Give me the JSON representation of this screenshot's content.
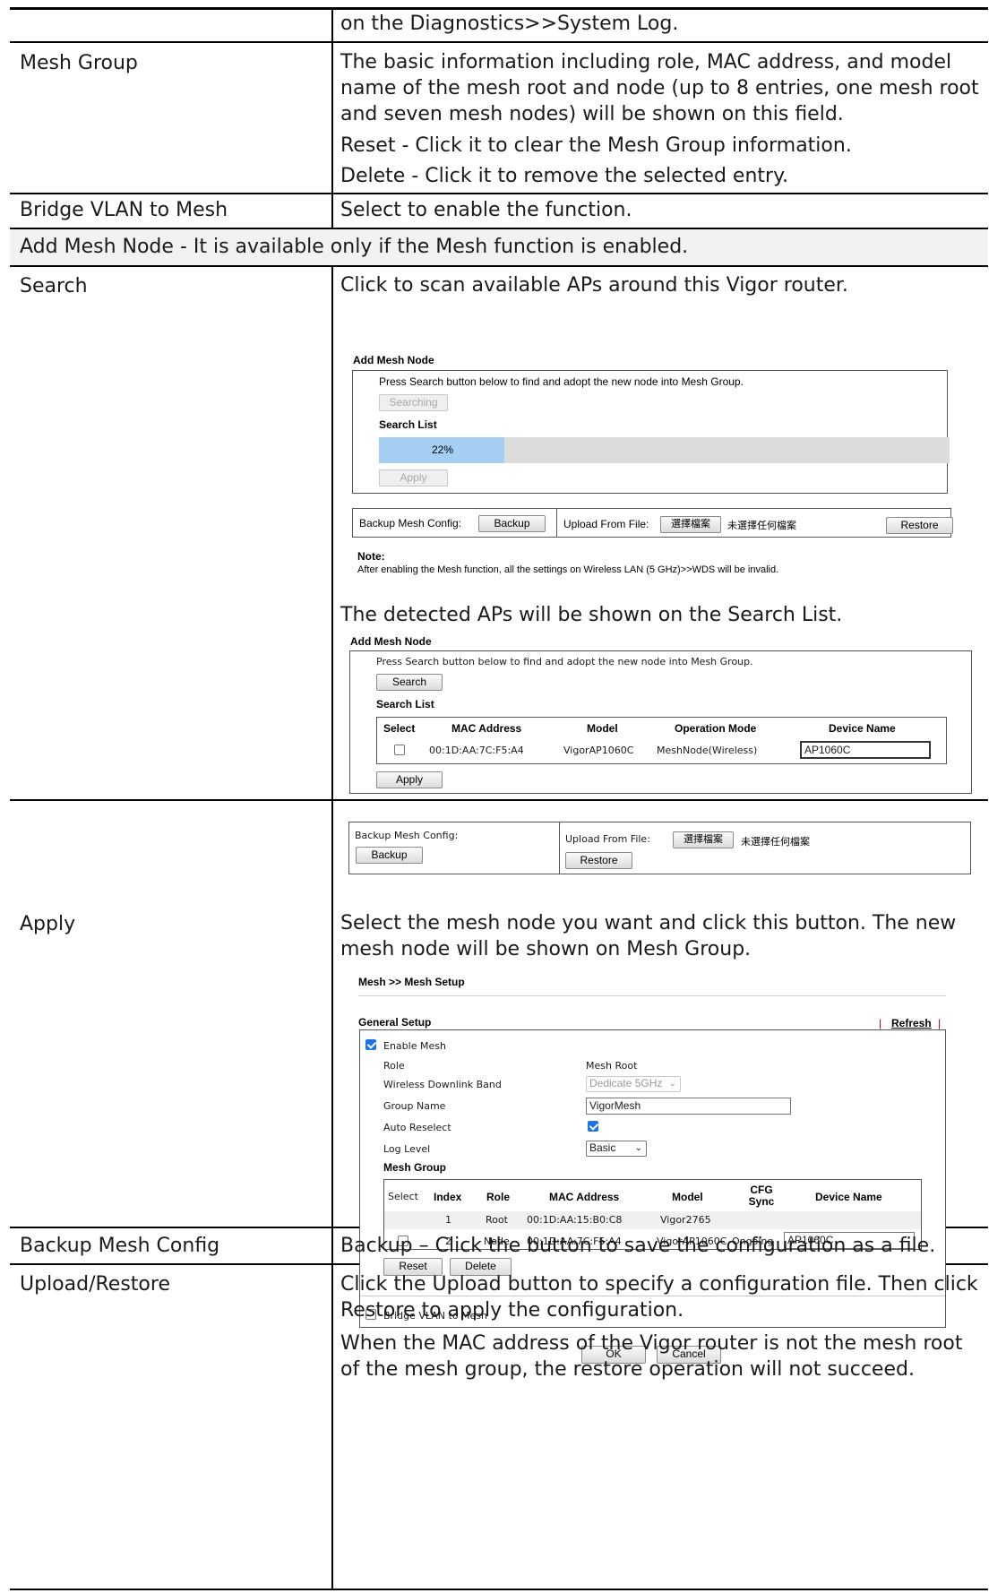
{
  "rows": [
    {
      "label": "",
      "text": "on the Diagnostics>>System Log."
    },
    {
      "label": "Mesh Group",
      "text": "The basic information including role, MAC address, and model name of the mesh root and node (up to 8 entries, one mesh root and seven mesh nodes) will be shown on this field.",
      "extra": [
        "Reset - Click it to clear the Mesh Group information.",
        "Delete - Click it to remove the selected entry."
      ]
    },
    {
      "label": "Bridge VLAN to Mesh",
      "text": "Select to enable the function."
    },
    {
      "label": "Search",
      "text": "Click to scan available APs around this Vigor router.",
      "text2": "The detected APs will be shown on the Search List."
    },
    {
      "label": "Apply",
      "text": "Select the mesh node you want and click this button. The new mesh node will be shown on Mesh Group."
    },
    {
      "label": "Backup Mesh Config",
      "text": "Backup – Click the button to save the configuration as a file."
    },
    {
      "label": "Upload/Restore",
      "text": "Click the Upload button to specify a configuration file. Then click Restore to apply the configuration.",
      "extra": [
        "When the MAC address of the Vigor router is not the mesh root of the mesh group, the restore operation will not succeed."
      ]
    }
  ],
  "section_header": "Add Mesh Node - It is available only if the Mesh function is enabled.",
  "shot1": {
    "title": "Add Mesh Node",
    "instruction": "Press Search button below to find and adopt the new node into Mesh Group.",
    "search_button": "Searching",
    "list_title": "Search List",
    "progress": 0.22,
    "progress_label": "22%",
    "apply": "Apply",
    "backup_label": "Backup Mesh Config:",
    "backup_button": "Backup",
    "upload_label": "Upload From File:",
    "choose_file": "選擇檔案",
    "no_file": "未選擇任何檔案",
    "restore": "Restore",
    "note_title": "Note:",
    "note": "After enabling the Mesh function, all the settings on Wireless LAN (5 GHz)>>WDS will be invalid."
  },
  "shot2": {
    "title": "Add Mesh Node",
    "instruction": "Press Search button below to find and adopt the new node into Mesh Group.",
    "search_button": "Search",
    "list_title": "Search List",
    "columns": [
      "Select",
      "MAC Address",
      "Model",
      "Operation Mode",
      "Device Name"
    ],
    "row": {
      "mac": "00:1D:AA:7C:F5:A4",
      "model": "VigorAP1060C",
      "mode": "MeshNode(Wireless)",
      "device": "AP1060C",
      "selected": false
    },
    "apply": "Apply",
    "backup_label": "Backup Mesh Config:",
    "backup_button": "Backup",
    "upload_label": "Upload From File:",
    "choose_file": "選擇檔案",
    "no_file": "未選擇任何檔案",
    "restore": "Restore"
  },
  "shot3": {
    "breadcrumb": "Mesh >> Mesh Setup",
    "section": "General Setup",
    "refresh": "Refresh",
    "enable_mesh": "Enable Mesh",
    "enable_mesh_checked": true,
    "role_label": "Role",
    "role_value": "Mesh Root",
    "band_label": "Wireless Downlink Band",
    "band_value": "Dedicate 5GHz",
    "group_label": "Group Name",
    "group_value": "VigorMesh",
    "reselect_label": "Auto Reselect",
    "reselect_checked": true,
    "log_label": "Log Level",
    "log_value": "Basic",
    "mesh_group_title": "Mesh Group",
    "columns": [
      "Select",
      "Index",
      "Role",
      "MAC Address",
      "Model",
      "CFG Sync",
      "Device Name"
    ],
    "rows": [
      {
        "index": "1",
        "role": "Root",
        "mac": "00:1D:AA:15:B0:C8",
        "model": "Vigor2765",
        "cfg": "",
        "device": ""
      },
      {
        "index": "2",
        "role": "Node",
        "mac": "00:1D:AA:7C:F5:A4",
        "model": "VigorAP1060C",
        "cfg": "Ongoing",
        "device": "AP1060C"
      }
    ],
    "reset": "Reset",
    "delete": "Delete",
    "bridge_vlan": "Bridge VLAN to Mesh",
    "bridge_checked": false,
    "ok": "OK",
    "cancel": "Cancel"
  }
}
